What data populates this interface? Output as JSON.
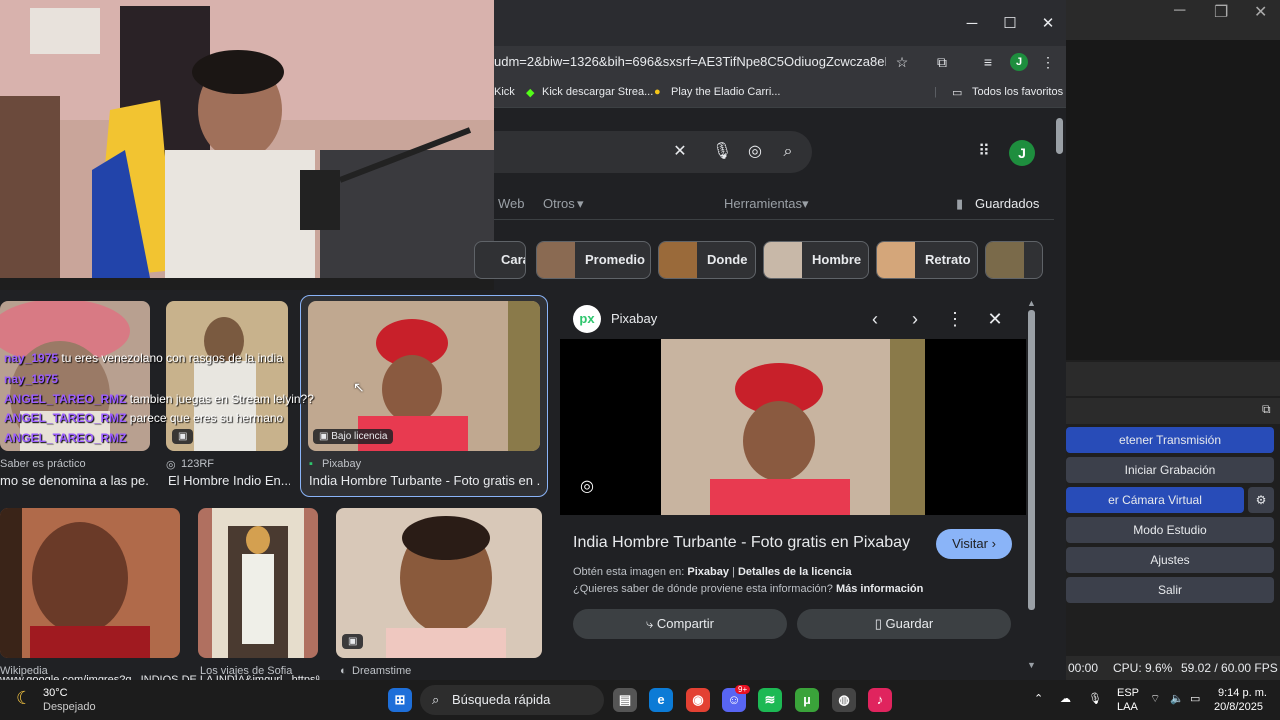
{
  "chrome": {
    "url": "udm=2&biw=1326&bih=696&sxsrf=AE3TifNpe8C5OdiuogZcwcza8eKFoz...",
    "profile_initial": "J",
    "bookmarks": [
      {
        "label": "Kick"
      },
      {
        "label": "Kick descargar Strea..."
      },
      {
        "label": "Play the Eladio Carri..."
      },
      {
        "label": "Todos los favoritos"
      }
    ]
  },
  "search": {
    "tabs": {
      "web": "Web",
      "otros": "Otros",
      "herramientas": "Herramientas",
      "guardados": "Guardados"
    },
    "chips": [
      "Cara",
      "Promedio",
      "Donde",
      "Hombre",
      "Retrato"
    ]
  },
  "results": [
    {
      "source": "Saber es práctico",
      "caption": "mo se denomina a las pe..."
    },
    {
      "source": "123RF",
      "caption": "El Hombre Indio En..."
    },
    {
      "source": "Pixabay",
      "caption": "India Hombre Turbante - Foto gratis en ...",
      "badge": "Bajo licencia"
    },
    {
      "source": "Wikipedia",
      "caption": "www.google.com/imgres?q...INDIOS DE LA INDIA&imgurl...https%3A%2..."
    },
    {
      "source": "Los viajes de Sofia",
      "caption": ""
    },
    {
      "source": "Dreamstime",
      "caption": ""
    }
  ],
  "chat": [
    {
      "user": "nay_1975",
      "msg": "tu eres venezolano con rasgos de la india"
    },
    {
      "user": "nay_1975",
      "msg": ""
    },
    {
      "user": "ANGEL_TAREO_RMZ",
      "msg": "tambien juegas en Stream lelyin??"
    },
    {
      "user": "ANGEL_TAREO_RMZ",
      "msg": "parece que eres su hermano"
    },
    {
      "user": "ANGEL_TAREO_RMZ",
      "msg": ""
    }
  ],
  "preview": {
    "source": "Pixabay",
    "logo_text": "px",
    "title": "India Hombre Turbante - Foto gratis en Pixabay",
    "visit": "Visitar",
    "line1_prefix": "Obtén esta imagen en:",
    "line1_src": "Pixabay",
    "line1_sep": "|",
    "line1_license": "Detalles de la licencia",
    "line2_prefix": "¿Quieres saber de dónde proviene esta información?",
    "line2_link": "Más información",
    "share": "Compartir",
    "save": "Guardar"
  },
  "obs": {
    "buttons": [
      "etener Transmisión",
      "Iniciar Grabación",
      "er Cámara Virtual",
      "Modo Estudio",
      "Ajustes",
      "Salir"
    ],
    "status": {
      "time": "00:00",
      "cpu": "CPU: 9.6%",
      "fps": "59.02 / 60.00 FPS"
    }
  },
  "taskbar": {
    "weather_temp": "30°C",
    "weather_desc": "Despejado",
    "search_placeholder": "Búsqueda rápida",
    "lang1": "ESP",
    "lang2": "LAA",
    "time": "9:14 p. m.",
    "date": "20/8/2025",
    "discord_badge": "9+"
  },
  "colors": {
    "accent_blue": "#8ab4f8",
    "obs_active": "#284cb8",
    "chat_user": "#9a5cff"
  }
}
